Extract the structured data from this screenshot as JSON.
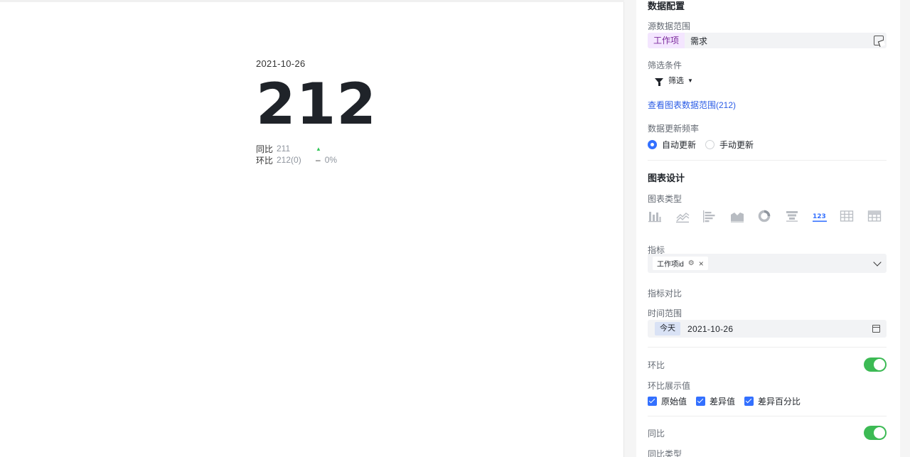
{
  "preview": {
    "date": "2021-10-26",
    "value": "212",
    "yoy_label": "同比",
    "yoy_value": "211",
    "yoy_trend": "▲",
    "mom_label": "环比",
    "mom_value": "212(0)",
    "mom_trend": "–",
    "mom_pct": "0%"
  },
  "data_config": {
    "title": "数据配置",
    "source_label": "源数据范围",
    "source_tag": "工作项",
    "source_value": "需求",
    "filter_label": "筛选条件",
    "filter_button": "筛选",
    "view_range_link": "查看图表数据范围(212)",
    "update_freq_label": "数据更新频率",
    "update_options": [
      "自动更新",
      "手动更新"
    ],
    "update_selected": "自动更新"
  },
  "chart_design": {
    "title": "图表设计",
    "chart_type_label": "图表类型",
    "chart_types": [
      "bar-chart-icon",
      "line-chart-icon",
      "horizontal-bar-icon",
      "area-chart-icon",
      "donut-chart-icon",
      "funnel-chart-icon",
      "number-card-icon",
      "table-icon",
      "pivot-table-icon"
    ],
    "selected_chart_type": "number-card-icon",
    "metric_label": "指标",
    "metric_chip": "工作项id",
    "metric_compare_label": "指标对比",
    "time_range_label": "时间范围",
    "time_tag": "今天",
    "time_value": "2021-10-26",
    "mom_toggle_label": "环比",
    "mom_toggle_on": true,
    "mom_display_label": "环比展示值",
    "mom_display_options": [
      "原始值",
      "差异值",
      "差异百分比"
    ],
    "yoy_toggle_label": "同比",
    "yoy_toggle_on": true,
    "yoy_type_label": "同比类型"
  },
  "colors": {
    "accent": "#3370ff",
    "toggle_on": "#3cba54",
    "trend_up": "#34c759",
    "number_card_icon": "#3370ff"
  }
}
